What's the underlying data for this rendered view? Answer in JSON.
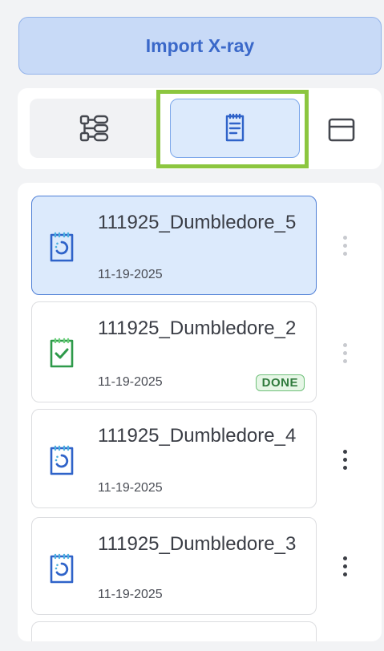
{
  "import_button": {
    "label": "Import X-ray"
  },
  "view_switcher": {
    "options": [
      {
        "icon": "tree-structure-icon",
        "selected": false
      },
      {
        "icon": "clipboard-list-icon",
        "selected": true
      },
      {
        "icon": "panel-layout-icon",
        "selected": false
      }
    ]
  },
  "cases": [
    {
      "title": "111925_Dumbledore_5",
      "date": "11-19-2025",
      "status_icon": "clipboard-progress-icon",
      "badge": "",
      "selected": true
    },
    {
      "title": "111925_Dumbledore_2",
      "date": "11-19-2025",
      "status_icon": "clipboard-check-icon",
      "badge": "DONE",
      "selected": false
    },
    {
      "title": "111925_Dumbledore_4",
      "date": "11-19-2025",
      "status_icon": "clipboard-progress-icon",
      "badge": "",
      "selected": false
    },
    {
      "title": "111925_Dumbledore_3",
      "date": "11-19-2025",
      "status_icon": "clipboard-progress-icon",
      "badge": "",
      "selected": false
    }
  ],
  "colors": {
    "accent_blue": "#3a68c9",
    "selected_bg": "#dceafc",
    "done_green": "#2f7a3c",
    "focus_ring": "#8cc63f"
  }
}
